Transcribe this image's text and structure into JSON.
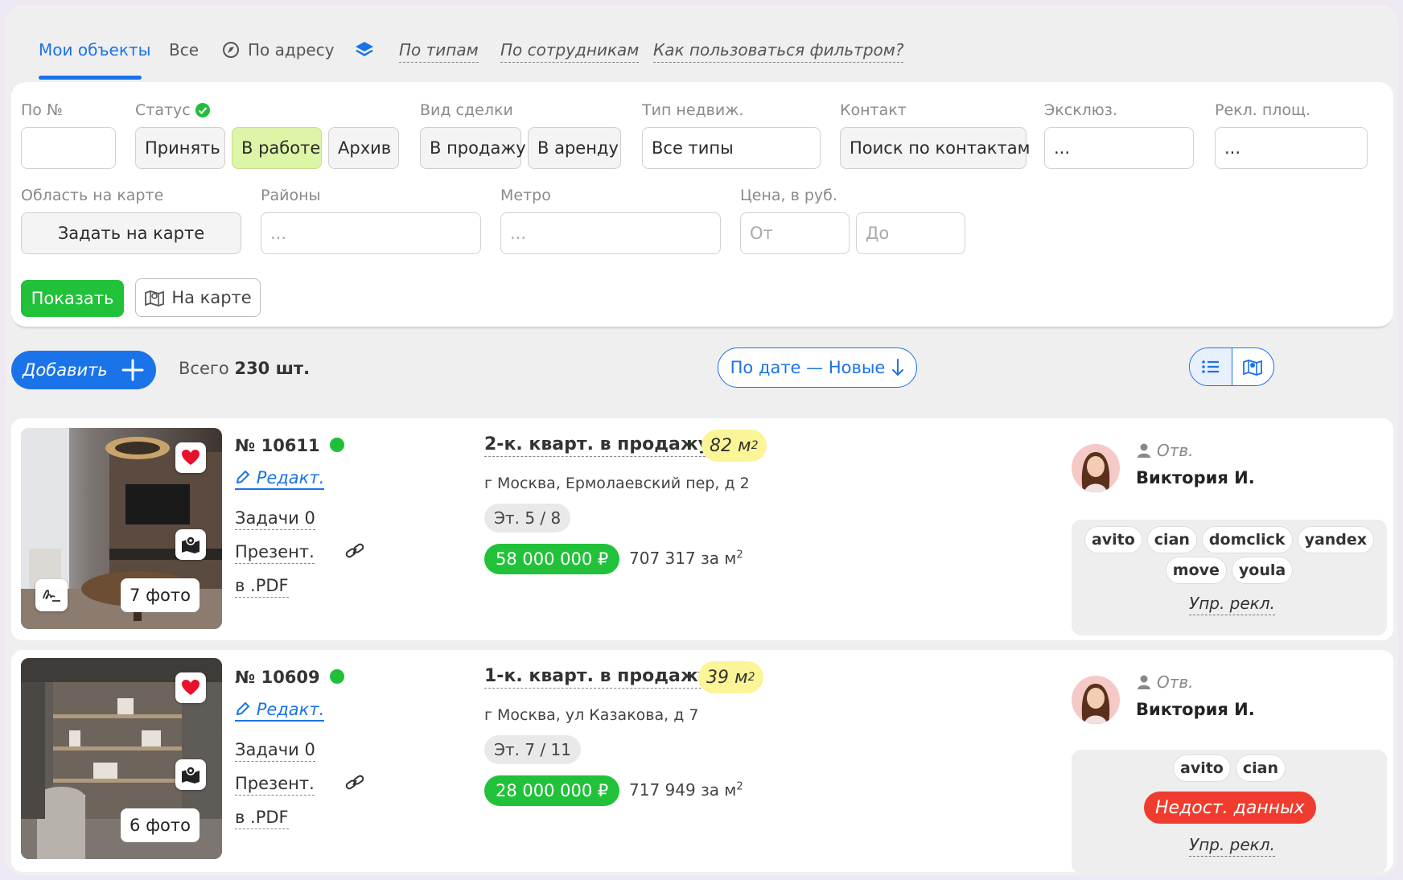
{
  "nav": {
    "tabs": [
      {
        "label": "Мои объекты"
      },
      {
        "label": "Все"
      },
      {
        "label": "По адресу"
      },
      {
        "label": "По типам"
      },
      {
        "label": "По сотрудникам"
      },
      {
        "label": "Как пользоваться фильтром?"
      }
    ]
  },
  "filters": {
    "number": {
      "label": "По №",
      "value": ""
    },
    "status": {
      "label": "Статус",
      "options": [
        "Принять",
        "В работе",
        "Архив"
      ],
      "selected": "В работе"
    },
    "deal": {
      "label": "Вид сделки",
      "options": [
        "В продажу",
        "В аренду"
      ]
    },
    "type": {
      "label": "Тип недвиж.",
      "value": "Все типы"
    },
    "contact": {
      "label": "Контакт",
      "value": "Поиск по контактам"
    },
    "exclusive": {
      "label": "Эксклюз.",
      "value": "..."
    },
    "adplatforms": {
      "label": "Рекл. площ.",
      "value": "..."
    },
    "maparea": {
      "label": "Область на карте",
      "button": "Задать на карте"
    },
    "districts": {
      "label": "Районы",
      "placeholder": "..."
    },
    "metro": {
      "label": "Метро",
      "placeholder": "..."
    },
    "price": {
      "label": "Цена, в руб.",
      "from_placeholder": "От",
      "to_placeholder": "До"
    },
    "show_button": "Показать",
    "onmap_button": "На карте"
  },
  "toolbar": {
    "add_button": "Добавить",
    "total_prefix": "Всего",
    "total_value": "230 шт.",
    "sort_label": "По дате — Новые"
  },
  "listings": [
    {
      "number": "№ 10611",
      "edit": "Редакт.",
      "tasks": "Задачи 0",
      "presentation": "Презент.",
      "pdf": "в .PDF",
      "photos": "7 фото",
      "title": "2-к. кварт. в продажу",
      "area": "82 м",
      "area_sup": "2",
      "address": "г Москва, Ермолаевский пер, д 2",
      "floor": "Эт. 5 / 8",
      "price": "58 000 000 ₽",
      "ppm": "707 317 за м",
      "ppm_sup": "2",
      "resp_label": "Отв.",
      "agent": "Виктория И.",
      "platforms_row1": [
        "avito",
        "cian",
        "domclick",
        "yandex"
      ],
      "platforms_row2": [
        "move",
        "youla"
      ],
      "ads_link": "Упр. рекл."
    },
    {
      "number": "№ 10609",
      "edit": "Редакт.",
      "tasks": "Задачи 0",
      "presentation": "Презент.",
      "pdf": "в .PDF",
      "photos": "6 фото",
      "title": "1-к. кварт. в продажу",
      "area": "39 м",
      "area_sup": "2",
      "address": "г Москва, ул Казакова, д 7",
      "floor": "Эт. 7 / 11",
      "price": "28 000 000 ₽",
      "ppm": "717 949 за м",
      "ppm_sup": "2",
      "resp_label": "Отв.",
      "agent": "Виктория И.",
      "platforms_row1": [
        "avito",
        "cian"
      ],
      "warning": "Недост. данных",
      "ads_link": "Упр. рекл."
    }
  ],
  "colors": {
    "accent": "#1a73e8",
    "green": "#22c13a",
    "selected": "#ddf5a6",
    "area_badge": "#fcf597",
    "warning": "#f03c2e"
  }
}
